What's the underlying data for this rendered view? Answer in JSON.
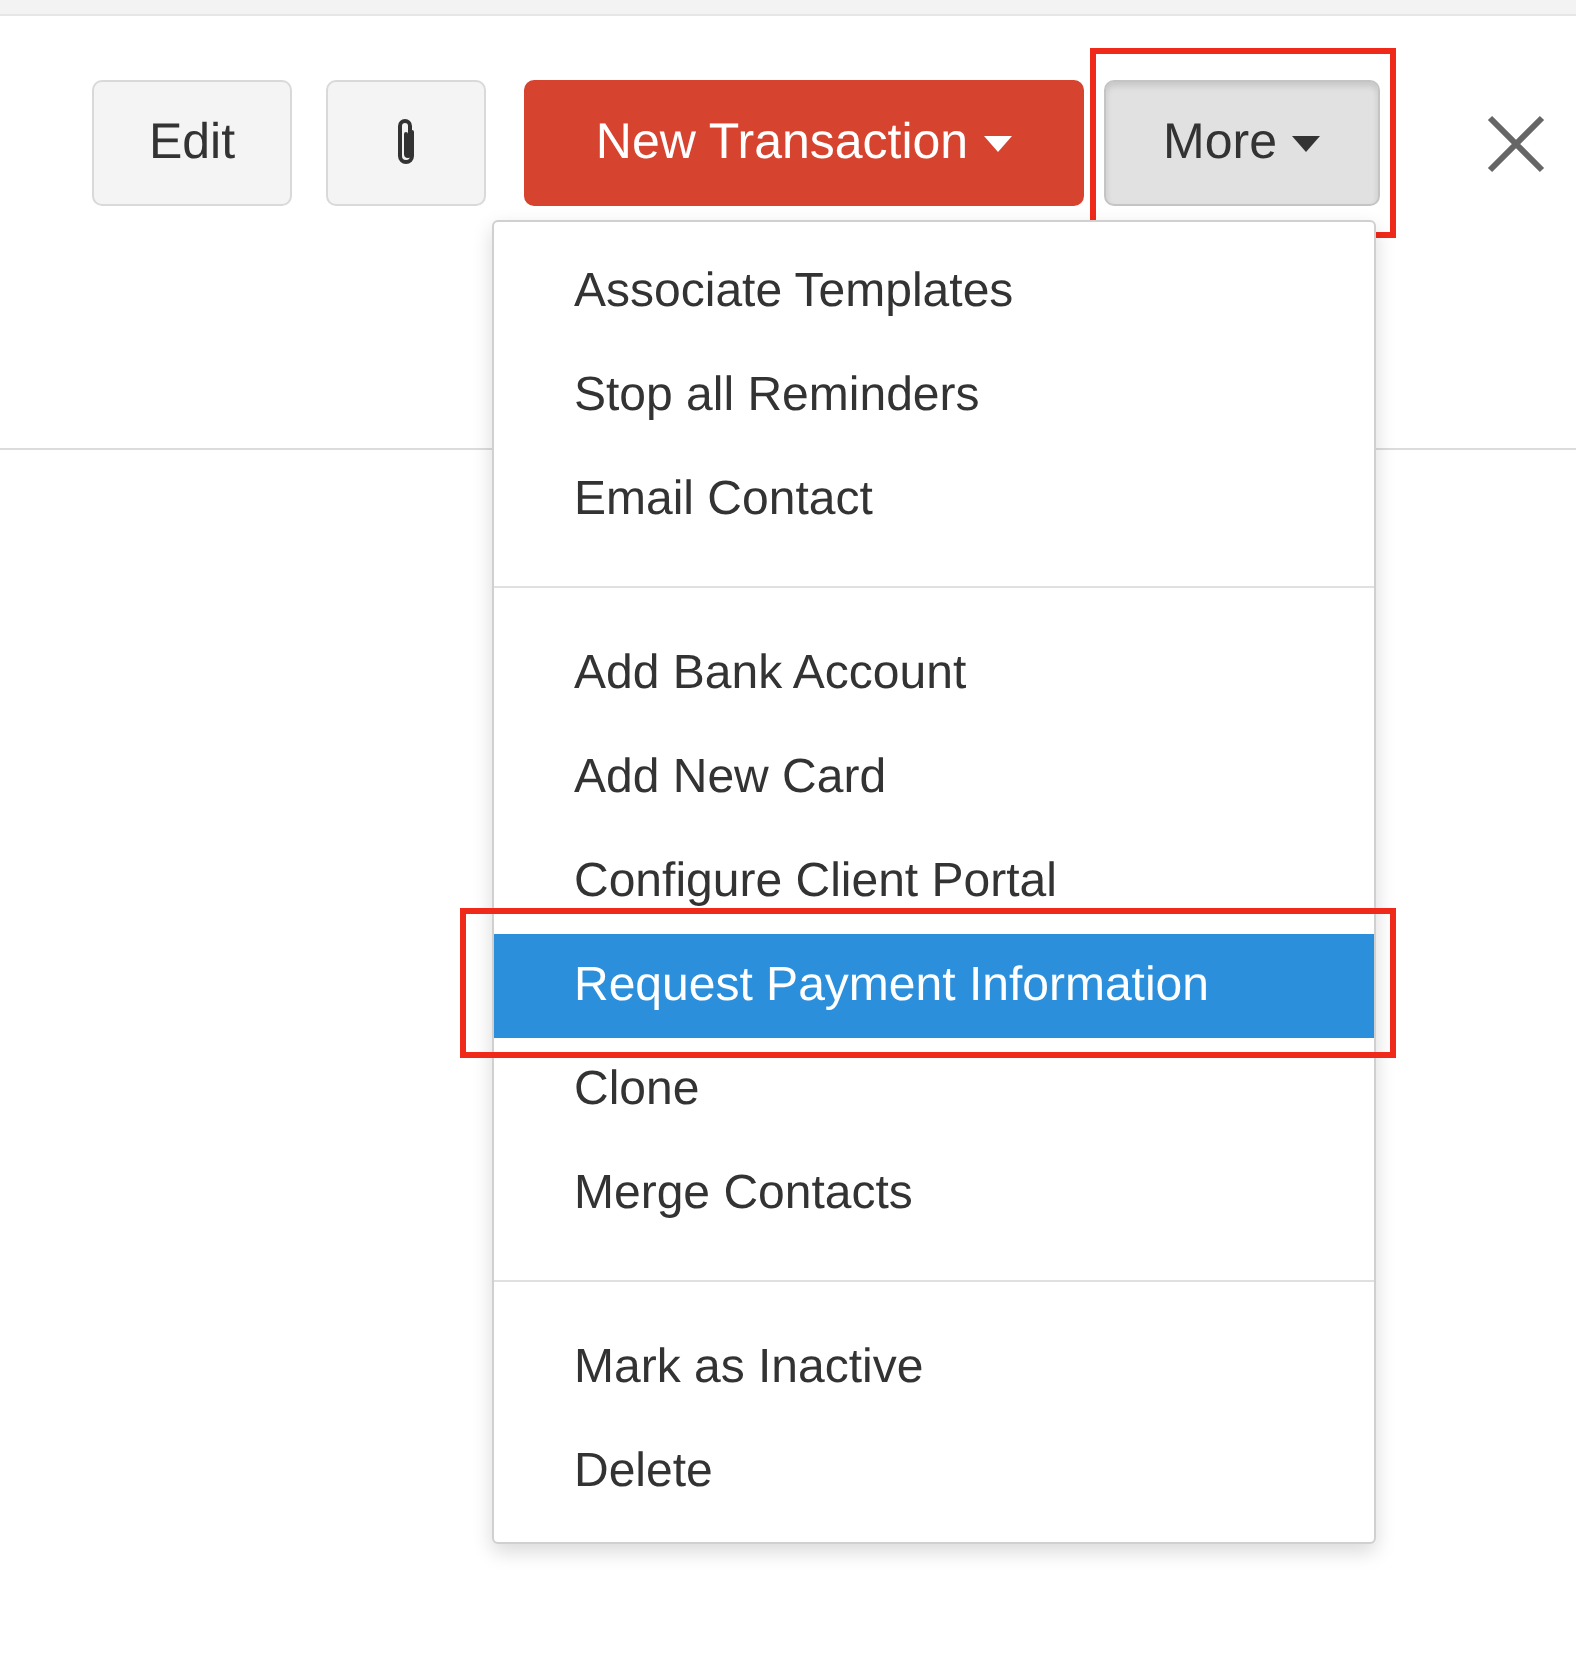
{
  "toolbar": {
    "edit_button": "Edit",
    "new_transaction_button": "New Transaction",
    "more_button": {
      "label": "More",
      "pressed": true,
      "annotated": true
    }
  },
  "menu": {
    "sections": [
      {
        "items": [
          {
            "label": "Associate Templates",
            "selected": false,
            "annotated": false
          },
          {
            "label": "Stop all Reminders",
            "selected": false,
            "annotated": false
          },
          {
            "label": "Email Contact",
            "selected": false,
            "annotated": false
          }
        ]
      },
      {
        "items": [
          {
            "label": "Add Bank Account",
            "selected": false,
            "annotated": false
          },
          {
            "label": "Add New Card",
            "selected": false,
            "annotated": false
          },
          {
            "label": "Configure Client Portal",
            "selected": false,
            "annotated": false
          },
          {
            "label": "Request Payment Information",
            "selected": true,
            "annotated": true
          },
          {
            "label": "Clone",
            "selected": false,
            "annotated": false
          },
          {
            "label": "Merge Contacts",
            "selected": false,
            "annotated": false
          }
        ]
      },
      {
        "items": [
          {
            "label": "Mark as Inactive",
            "selected": false,
            "annotated": false
          },
          {
            "label": "Delete",
            "selected": false,
            "annotated": false
          }
        ]
      }
    ]
  }
}
